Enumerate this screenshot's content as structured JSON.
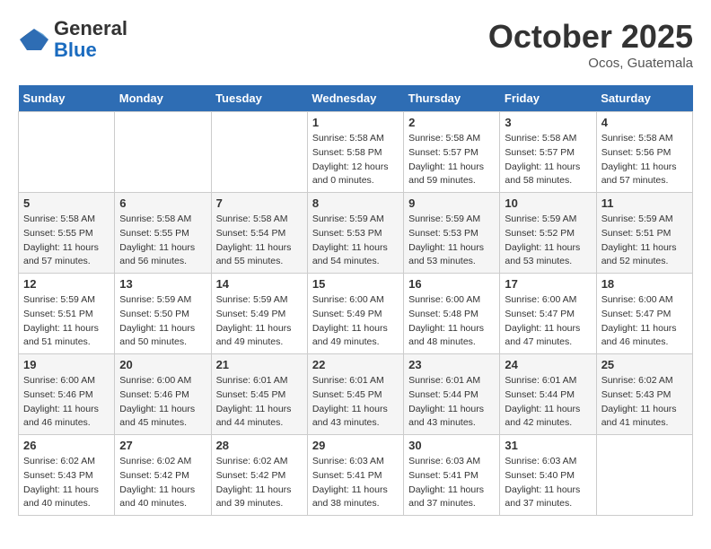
{
  "header": {
    "logo_general": "General",
    "logo_blue": "Blue",
    "month": "October 2025",
    "location": "Ocos, Guatemala"
  },
  "weekdays": [
    "Sunday",
    "Monday",
    "Tuesday",
    "Wednesday",
    "Thursday",
    "Friday",
    "Saturday"
  ],
  "weeks": [
    [
      {
        "day": "",
        "sunrise": "",
        "sunset": "",
        "daylight": ""
      },
      {
        "day": "",
        "sunrise": "",
        "sunset": "",
        "daylight": ""
      },
      {
        "day": "",
        "sunrise": "",
        "sunset": "",
        "daylight": ""
      },
      {
        "day": "1",
        "sunrise": "Sunrise: 5:58 AM",
        "sunset": "Sunset: 5:58 PM",
        "daylight": "Daylight: 12 hours and 0 minutes."
      },
      {
        "day": "2",
        "sunrise": "Sunrise: 5:58 AM",
        "sunset": "Sunset: 5:57 PM",
        "daylight": "Daylight: 11 hours and 59 minutes."
      },
      {
        "day": "3",
        "sunrise": "Sunrise: 5:58 AM",
        "sunset": "Sunset: 5:57 PM",
        "daylight": "Daylight: 11 hours and 58 minutes."
      },
      {
        "day": "4",
        "sunrise": "Sunrise: 5:58 AM",
        "sunset": "Sunset: 5:56 PM",
        "daylight": "Daylight: 11 hours and 57 minutes."
      }
    ],
    [
      {
        "day": "5",
        "sunrise": "Sunrise: 5:58 AM",
        "sunset": "Sunset: 5:55 PM",
        "daylight": "Daylight: 11 hours and 57 minutes."
      },
      {
        "day": "6",
        "sunrise": "Sunrise: 5:58 AM",
        "sunset": "Sunset: 5:55 PM",
        "daylight": "Daylight: 11 hours and 56 minutes."
      },
      {
        "day": "7",
        "sunrise": "Sunrise: 5:58 AM",
        "sunset": "Sunset: 5:54 PM",
        "daylight": "Daylight: 11 hours and 55 minutes."
      },
      {
        "day": "8",
        "sunrise": "Sunrise: 5:59 AM",
        "sunset": "Sunset: 5:53 PM",
        "daylight": "Daylight: 11 hours and 54 minutes."
      },
      {
        "day": "9",
        "sunrise": "Sunrise: 5:59 AM",
        "sunset": "Sunset: 5:53 PM",
        "daylight": "Daylight: 11 hours and 53 minutes."
      },
      {
        "day": "10",
        "sunrise": "Sunrise: 5:59 AM",
        "sunset": "Sunset: 5:52 PM",
        "daylight": "Daylight: 11 hours and 53 minutes."
      },
      {
        "day": "11",
        "sunrise": "Sunrise: 5:59 AM",
        "sunset": "Sunset: 5:51 PM",
        "daylight": "Daylight: 11 hours and 52 minutes."
      }
    ],
    [
      {
        "day": "12",
        "sunrise": "Sunrise: 5:59 AM",
        "sunset": "Sunset: 5:51 PM",
        "daylight": "Daylight: 11 hours and 51 minutes."
      },
      {
        "day": "13",
        "sunrise": "Sunrise: 5:59 AM",
        "sunset": "Sunset: 5:50 PM",
        "daylight": "Daylight: 11 hours and 50 minutes."
      },
      {
        "day": "14",
        "sunrise": "Sunrise: 5:59 AM",
        "sunset": "Sunset: 5:49 PM",
        "daylight": "Daylight: 11 hours and 49 minutes."
      },
      {
        "day": "15",
        "sunrise": "Sunrise: 6:00 AM",
        "sunset": "Sunset: 5:49 PM",
        "daylight": "Daylight: 11 hours and 49 minutes."
      },
      {
        "day": "16",
        "sunrise": "Sunrise: 6:00 AM",
        "sunset": "Sunset: 5:48 PM",
        "daylight": "Daylight: 11 hours and 48 minutes."
      },
      {
        "day": "17",
        "sunrise": "Sunrise: 6:00 AM",
        "sunset": "Sunset: 5:47 PM",
        "daylight": "Daylight: 11 hours and 47 minutes."
      },
      {
        "day": "18",
        "sunrise": "Sunrise: 6:00 AM",
        "sunset": "Sunset: 5:47 PM",
        "daylight": "Daylight: 11 hours and 46 minutes."
      }
    ],
    [
      {
        "day": "19",
        "sunrise": "Sunrise: 6:00 AM",
        "sunset": "Sunset: 5:46 PM",
        "daylight": "Daylight: 11 hours and 46 minutes."
      },
      {
        "day": "20",
        "sunrise": "Sunrise: 6:00 AM",
        "sunset": "Sunset: 5:46 PM",
        "daylight": "Daylight: 11 hours and 45 minutes."
      },
      {
        "day": "21",
        "sunrise": "Sunrise: 6:01 AM",
        "sunset": "Sunset: 5:45 PM",
        "daylight": "Daylight: 11 hours and 44 minutes."
      },
      {
        "day": "22",
        "sunrise": "Sunrise: 6:01 AM",
        "sunset": "Sunset: 5:45 PM",
        "daylight": "Daylight: 11 hours and 43 minutes."
      },
      {
        "day": "23",
        "sunrise": "Sunrise: 6:01 AM",
        "sunset": "Sunset: 5:44 PM",
        "daylight": "Daylight: 11 hours and 43 minutes."
      },
      {
        "day": "24",
        "sunrise": "Sunrise: 6:01 AM",
        "sunset": "Sunset: 5:44 PM",
        "daylight": "Daylight: 11 hours and 42 minutes."
      },
      {
        "day": "25",
        "sunrise": "Sunrise: 6:02 AM",
        "sunset": "Sunset: 5:43 PM",
        "daylight": "Daylight: 11 hours and 41 minutes."
      }
    ],
    [
      {
        "day": "26",
        "sunrise": "Sunrise: 6:02 AM",
        "sunset": "Sunset: 5:43 PM",
        "daylight": "Daylight: 11 hours and 40 minutes."
      },
      {
        "day": "27",
        "sunrise": "Sunrise: 6:02 AM",
        "sunset": "Sunset: 5:42 PM",
        "daylight": "Daylight: 11 hours and 40 minutes."
      },
      {
        "day": "28",
        "sunrise": "Sunrise: 6:02 AM",
        "sunset": "Sunset: 5:42 PM",
        "daylight": "Daylight: 11 hours and 39 minutes."
      },
      {
        "day": "29",
        "sunrise": "Sunrise: 6:03 AM",
        "sunset": "Sunset: 5:41 PM",
        "daylight": "Daylight: 11 hours and 38 minutes."
      },
      {
        "day": "30",
        "sunrise": "Sunrise: 6:03 AM",
        "sunset": "Sunset: 5:41 PM",
        "daylight": "Daylight: 11 hours and 37 minutes."
      },
      {
        "day": "31",
        "sunrise": "Sunrise: 6:03 AM",
        "sunset": "Sunset: 5:40 PM",
        "daylight": "Daylight: 11 hours and 37 minutes."
      },
      {
        "day": "",
        "sunrise": "",
        "sunset": "",
        "daylight": ""
      }
    ]
  ]
}
